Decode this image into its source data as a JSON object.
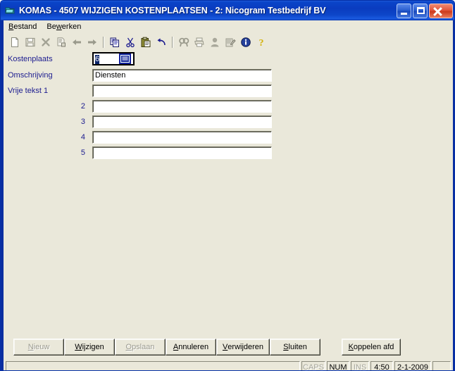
{
  "window": {
    "title": "KOMAS - 4507 WIJZIGEN KOSTENPLAATSEN - 2: Nicogram Testbedrijf BV",
    "icon": "app-folder-icon",
    "controls": {
      "minimize": "minimize-button",
      "maximize": "maximize-button",
      "close": "close-button"
    },
    "colors": {
      "titlebar": "#0a3cbf",
      "client_background": "#eae8da",
      "label_text": "#1b1b8f",
      "selection": "#0a246a",
      "close_button": "#cc3a1c"
    }
  },
  "menubar": {
    "items": [
      {
        "label": "Bestand",
        "accel": "B"
      },
      {
        "label": "Bewerken",
        "accel": "w"
      }
    ]
  },
  "toolbar": {
    "groups": [
      [
        {
          "name": "new-icon",
          "enabled": true
        },
        {
          "name": "save-icon",
          "enabled": false
        },
        {
          "name": "delete-icon",
          "enabled": false
        },
        {
          "name": "save-as-icon",
          "enabled": false
        },
        {
          "name": "previous-icon",
          "enabled": true
        },
        {
          "name": "next-icon",
          "enabled": true
        }
      ],
      [
        {
          "name": "copy-icon",
          "enabled": true
        },
        {
          "name": "cut-icon",
          "enabled": true
        },
        {
          "name": "paste-icon",
          "enabled": true
        },
        {
          "name": "undo-icon",
          "enabled": true
        }
      ],
      [
        {
          "name": "find-icon",
          "enabled": false
        },
        {
          "name": "print-icon",
          "enabled": false
        },
        {
          "name": "contact-icon",
          "enabled": false
        },
        {
          "name": "edit-note-icon",
          "enabled": false
        },
        {
          "name": "info-icon",
          "enabled": true
        },
        {
          "name": "help-icon",
          "enabled": true
        }
      ]
    ]
  },
  "form": {
    "fields": [
      {
        "label": "Kostenplaats",
        "value": "6",
        "selected": true,
        "has_lookup": true,
        "lookup_icon": "list-lookup-icon"
      },
      {
        "label": "Omschrijving",
        "value": "Diensten",
        "selected": false,
        "has_lookup": false
      },
      {
        "label": "Vrije tekst 1",
        "value": "",
        "selected": false,
        "has_lookup": false
      },
      {
        "label": "2",
        "value": "",
        "selected": false,
        "has_lookup": false
      },
      {
        "label": "3",
        "value": "",
        "selected": false,
        "has_lookup": false
      },
      {
        "label": "4",
        "value": "",
        "selected": false,
        "has_lookup": false
      },
      {
        "label": "5",
        "value": "",
        "selected": false,
        "has_lookup": false
      }
    ]
  },
  "buttons": [
    {
      "label": "Nieuw",
      "accel": "N",
      "enabled": false
    },
    {
      "label": "Wijzigen",
      "accel": "W",
      "enabled": true
    },
    {
      "label": "Opslaan",
      "accel": "O",
      "enabled": false
    },
    {
      "label": "Annuleren",
      "accel": "A",
      "enabled": true
    },
    {
      "label": "Verwijderen",
      "accel": "V",
      "enabled": true
    },
    {
      "label": "Sluiten",
      "accel": "S",
      "enabled": true
    },
    {
      "label": "Koppelen afd",
      "accel": "K",
      "enabled": true
    }
  ],
  "statusbar": {
    "message": "",
    "indicators": [
      {
        "label": "CAPS",
        "active": false
      },
      {
        "label": "NUM",
        "active": true
      },
      {
        "label": "INS",
        "active": false
      }
    ],
    "time": "4:50",
    "date": "2-1-2009"
  }
}
